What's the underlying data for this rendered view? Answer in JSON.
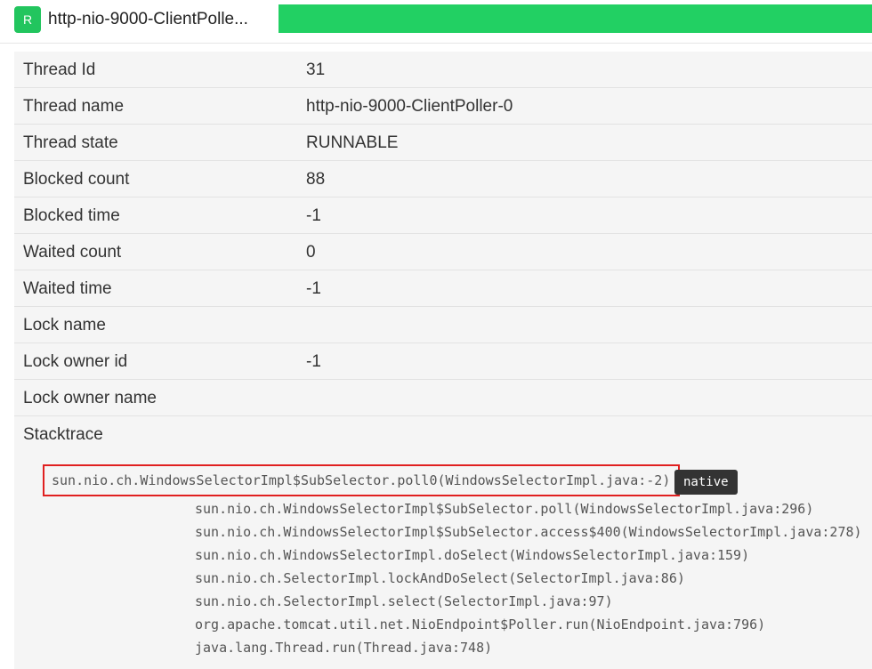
{
  "header": {
    "badge": "R",
    "title": "http-nio-9000-ClientPolle...",
    "progress_fraction": 1.0,
    "progress_color": "#22d063"
  },
  "details": [
    {
      "label": "Thread Id",
      "value": "31"
    },
    {
      "label": "Thread name",
      "value": "http-nio-9000-ClientPoller-0"
    },
    {
      "label": "Thread state",
      "value": "RUNNABLE"
    },
    {
      "label": "Blocked count",
      "value": "88"
    },
    {
      "label": "Blocked time",
      "value": "-1"
    },
    {
      "label": "Waited count",
      "value": "0"
    },
    {
      "label": "Waited time",
      "value": "-1"
    },
    {
      "label": "Lock name",
      "value": ""
    },
    {
      "label": "Lock owner id",
      "value": "-1"
    },
    {
      "label": "Lock owner name",
      "value": ""
    }
  ],
  "stacktrace": {
    "label": "Stacktrace",
    "native_badge": "native",
    "highlight_color": "#e02020",
    "frames": [
      "sun.nio.ch.WindowsSelectorImpl$SubSelector.poll0(WindowsSelectorImpl.java:-2)",
      "sun.nio.ch.WindowsSelectorImpl$SubSelector.poll(WindowsSelectorImpl.java:296)",
      "sun.nio.ch.WindowsSelectorImpl$SubSelector.access$400(WindowsSelectorImpl.java:278)",
      "sun.nio.ch.WindowsSelectorImpl.doSelect(WindowsSelectorImpl.java:159)",
      "sun.nio.ch.SelectorImpl.lockAndDoSelect(SelectorImpl.java:86)",
      "sun.nio.ch.SelectorImpl.select(SelectorImpl.java:97)",
      "org.apache.tomcat.util.net.NioEndpoint$Poller.run(NioEndpoint.java:796)",
      "java.lang.Thread.run(Thread.java:748)"
    ]
  }
}
